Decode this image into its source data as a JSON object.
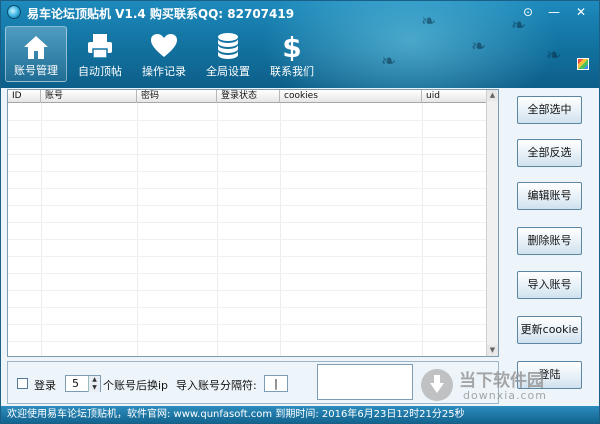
{
  "window": {
    "title": "易车论坛顶贴机 V1.4 购买联系QQ: 82707419",
    "buttons": {
      "skin": "⊙",
      "minimize": "—",
      "close": "✕"
    }
  },
  "nav": [
    {
      "label": "账号管理",
      "icon": "home-icon",
      "active": true
    },
    {
      "label": "自动顶帖",
      "icon": "printer-icon",
      "active": false
    },
    {
      "label": "操作记录",
      "icon": "heart-icon",
      "active": false
    },
    {
      "label": "全局设置",
      "icon": "database-icon",
      "active": false
    },
    {
      "label": "联系我们",
      "icon": "dollar-icon",
      "active": false
    }
  ],
  "table": {
    "columns": [
      "ID",
      "账号",
      "密码",
      "登录状态",
      "cookies",
      "uid"
    ],
    "rows": []
  },
  "actions": {
    "select_all": "全部选中",
    "invert_selection": "全部反选",
    "edit_account": "编辑账号",
    "delete_account": "删除账号",
    "import_account": "导入账号",
    "update_cookie": "更新cookie",
    "login": "登陆"
  },
  "options": {
    "login_label": "登录",
    "change_ip_count": "5",
    "change_ip_suffix": "个账号后换ip",
    "separator_label": "导入账号分隔符:",
    "separator_value": "|"
  },
  "status_bar": {
    "text": "欢迎使用易车论坛顶贴机，软件官网: www.qunfasoft.com 到期时间: 2016年6月23日12时21分25秒"
  },
  "watermark": {
    "big": "当下软件园",
    "small": "downxia.com"
  },
  "colors": {
    "header": "#1477a6",
    "status_bar": "#13648f",
    "button_border": "#5d86a3"
  }
}
